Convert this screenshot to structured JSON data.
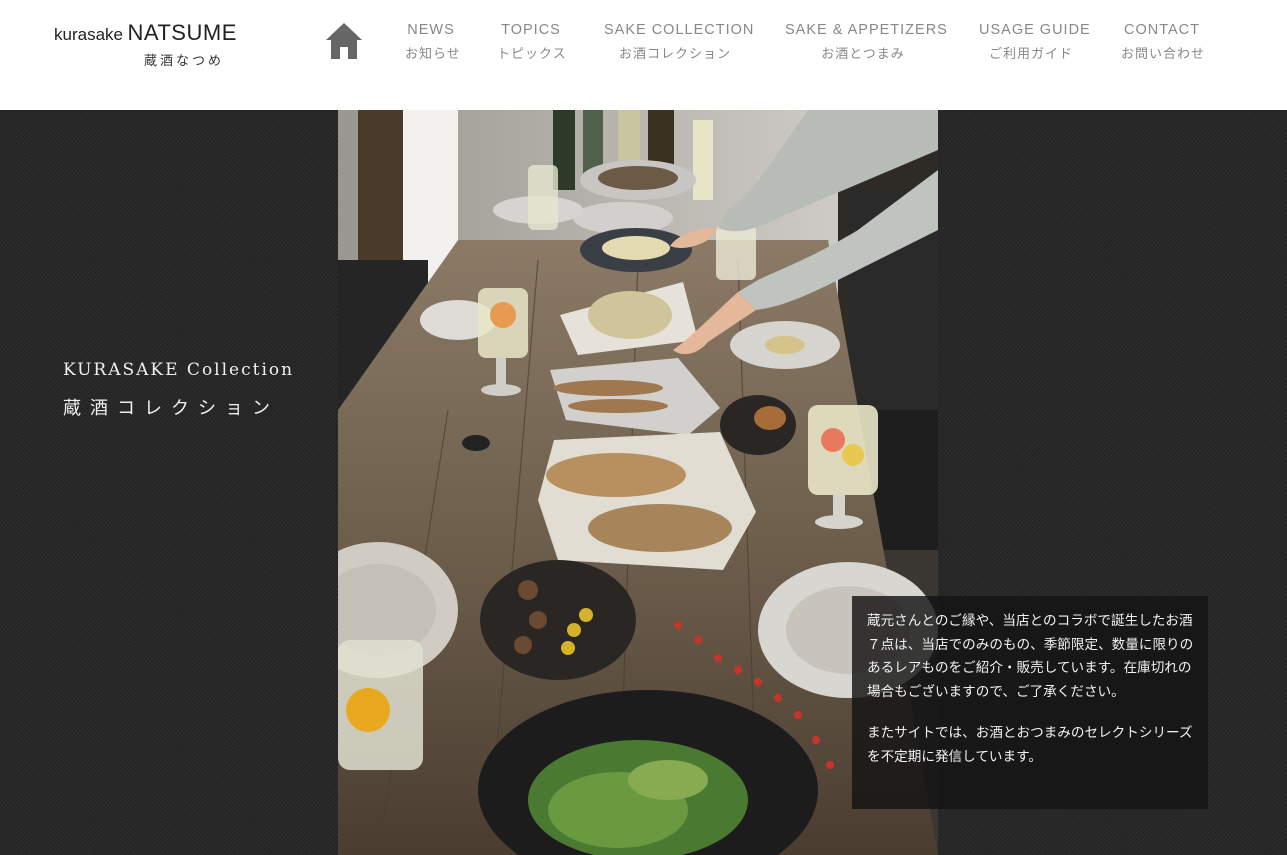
{
  "header": {
    "logo_small": "kurasake",
    "logo_big": "NATSUME",
    "logo_ja": "蔵酒なつめ",
    "home_icon": "home-icon",
    "nav": [
      {
        "en": "NEWS",
        "ja": "お知らせ"
      },
      {
        "en": "TOPICS",
        "ja": "トピックス"
      },
      {
        "en": "SAKE COLLECTION",
        "ja": "お酒コレクション"
      },
      {
        "en": "SAKE & APPETIZERS",
        "ja": "お酒とつまみ"
      },
      {
        "en": "USAGE GUIDE",
        "ja": "ご利用ガイド"
      },
      {
        "en": "CONTACT",
        "ja": "お問い合わせ"
      }
    ]
  },
  "hero": {
    "title_en": "KURASAKE Collection",
    "title_ja": "蔵酒コレクション",
    "paragraph_1": "蔵元さんとのご縁や、当店とのコラボで誕生したお酒７点は、当店でのみのもの、季節限定、数量に限りのあるレアものをご紹介・販売しています。在庫切れの場合もございますので、ご了承ください。",
    "paragraph_2": "またサイトでは、お酒とおつまみのセレクトシリーズを不定期に発信しています。"
  },
  "colors": {
    "header_bg": "#ffffff",
    "nav_text": "#888888",
    "hero_bg": "#282828",
    "textbox_bg": "rgba(20,20,20,0.82)"
  }
}
